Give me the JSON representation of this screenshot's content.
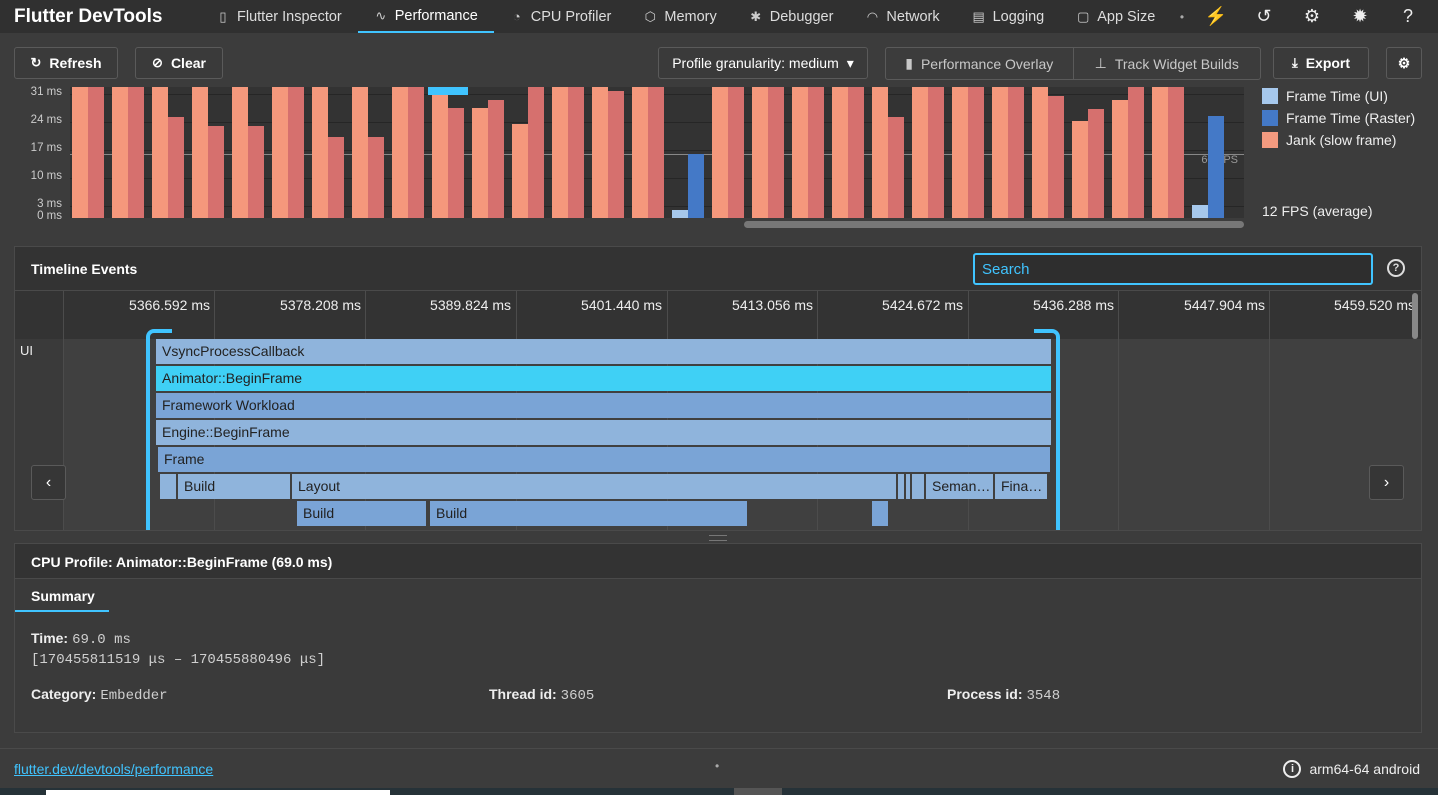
{
  "app_title": "Flutter DevTools",
  "tabs": [
    {
      "label": "Flutter Inspector",
      "icon": "phone-icon"
    },
    {
      "label": "Performance",
      "icon": "pulse-icon"
    },
    {
      "label": "CPU Profiler",
      "icon": "gauge-icon"
    },
    {
      "label": "Memory",
      "icon": "cube-icon"
    },
    {
      "label": "Debugger",
      "icon": "bug-icon"
    },
    {
      "label": "Network",
      "icon": "wifi-icon"
    },
    {
      "label": "Logging",
      "icon": "clipboard-icon"
    },
    {
      "label": "App Size",
      "icon": "file-icon"
    }
  ],
  "active_tab": "Performance",
  "toolbar": {
    "refresh_label": "Refresh",
    "clear_label": "Clear",
    "granularity_label": "Profile granularity: medium",
    "performance_overlay_label": "Performance Overlay",
    "track_widget_builds_label": "Track Widget Builds",
    "export_label": "Export"
  },
  "frame_chart": {
    "y_ticks": [
      "31 ms",
      "24 ms",
      "17 ms",
      "10 ms",
      "3 ms",
      "0 ms"
    ],
    "fps_line_label": "60 FPS",
    "legend": [
      {
        "label": "Frame Time (UI)",
        "color": "#a6c8ec"
      },
      {
        "label": "Frame Time (Raster)",
        "color": "#4479c7"
      },
      {
        "label": "Jank (slow frame)",
        "color": "#f49a7f"
      }
    ],
    "fps_average": "12 FPS (average)",
    "colors": {
      "ui_jank": "#f5987c",
      "raster_jank": "#d6706e",
      "ui": "#a6c8ec",
      "raster": "#4479c7",
      "selection": "#40c4ff"
    }
  },
  "timeline": {
    "title": "Timeline Events",
    "search_placeholder": "Search",
    "ticks": [
      "5366.592 ms",
      "5378.208 ms",
      "5389.824 ms",
      "5401.440 ms",
      "5413.056 ms",
      "5424.672 ms",
      "5436.288 ms",
      "5447.904 ms",
      "5459.520 ms"
    ],
    "row_label": "UI",
    "events": {
      "vsync": "VsyncProcessCallback",
      "animator": "Animator::BeginFrame",
      "framework": "Framework Workload",
      "engine": "Engine::BeginFrame",
      "frame": "Frame",
      "build1": "Build",
      "layout": "Layout",
      "semantics": "Seman…",
      "finalize": "Fina…",
      "build2": "Build",
      "build3": "Build"
    }
  },
  "cpu_profile": {
    "title": "CPU Profile: Animator::BeginFrame (69.0 ms)",
    "tab": "Summary",
    "time_label": "Time:",
    "time_value": "69.0 ms",
    "time_range": "[170455811519 μs –  170455880496 μs]",
    "category_label": "Category:",
    "category_value": "Embedder",
    "thread_label": "Thread id:",
    "thread_value": "3605",
    "process_label": "Process id:",
    "process_value": "3548"
  },
  "footer": {
    "link": "flutter.dev/devtools/performance",
    "device": "arm64-64 android"
  }
}
